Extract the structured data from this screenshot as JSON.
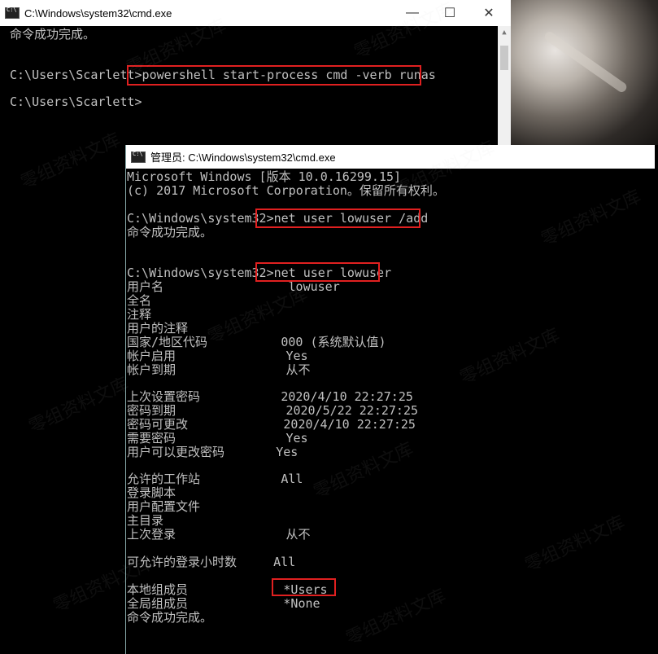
{
  "window1": {
    "title": "C:\\Windows\\system32\\cmd.exe",
    "minimize": "—",
    "maximize": "☐",
    "close": "✕",
    "lines": [
      "命令成功完成。",
      "",
      "C:\\Users\\Scarlett>powershell start-process cmd -verb runas",
      "",
      "C:\\Users\\Scarlett>"
    ]
  },
  "window2": {
    "title": "管理员: C:\\Windows\\system32\\cmd.exe",
    "lines": [
      "Microsoft Windows [版本 10.0.16299.15]",
      "(c) 2017 Microsoft Corporation。保留所有权利。",
      "",
      "C:\\Windows\\system32>net user lowuser /add",
      "命令成功完成。",
      "",
      "",
      "C:\\Windows\\system32>net user lowuser",
      "用户名                 lowuser",
      "全名",
      "注释",
      "用户的注释",
      "国家/地区代码          000 (系统默认值)",
      "帐户启用               Yes",
      "帐户到期               从不",
      "",
      "上次设置密码           2020/4/10 22:27:25",
      "密码到期               2020/5/22 22:27:25",
      "密码可更改             2020/4/10 22:27:25",
      "需要密码               Yes",
      "用户可以更改密码       Yes",
      "",
      "允许的工作站           All",
      "登录脚本",
      "用户配置文件",
      "主目录",
      "上次登录               从不",
      "",
      "可允许的登录小时数     All",
      "",
      "本地组成员             *Users",
      "全局组成员             *None",
      "命令成功完成。"
    ]
  },
  "watermark": "零组资料文库"
}
